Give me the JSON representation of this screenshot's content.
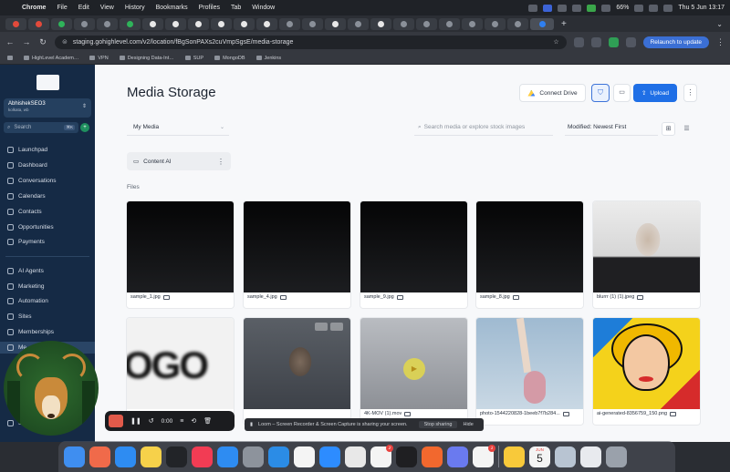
{
  "menubar": {
    "apple": "",
    "items": [
      "Chrome",
      "File",
      "Edit",
      "View",
      "History",
      "Bookmarks",
      "Profiles",
      "Tab",
      "Window"
    ],
    "battery": "66%",
    "datetime": "Thu 5 Jun  13:17"
  },
  "browser": {
    "new_tab": "+",
    "url": "staging.gohighlevel.com/v2/location/fBgSonPAXs2cuVmpSgsE/media-storage",
    "relaunch": "Relaunch to update",
    "bookmarks": [
      "HighLevel Academ…",
      "VPN",
      "Designing Data-Int…",
      "SUP",
      "MongoDB",
      "Jenkins"
    ]
  },
  "sidebar": {
    "account_name": "AbhishekSEO3",
    "account_sub": "kolkata, wb",
    "search_placeholder": "Search",
    "search_shortcut": "⌘K",
    "items": [
      {
        "label": "Launchpad",
        "icon": "rocket-icon"
      },
      {
        "label": "Dashboard",
        "icon": "dashboard-icon"
      },
      {
        "label": "Conversations",
        "icon": "chat-icon"
      },
      {
        "label": "Calendars",
        "icon": "calendar-icon"
      },
      {
        "label": "Contacts",
        "icon": "contacts-icon"
      },
      {
        "label": "Opportunities",
        "icon": "opportunities-icon"
      },
      {
        "label": "Payments",
        "icon": "payments-icon"
      },
      {
        "label": "AI Agents",
        "icon": "ai-agents-icon"
      },
      {
        "label": "Marketing",
        "icon": "marketing-icon"
      },
      {
        "label": "Automation",
        "icon": "automation-icon"
      },
      {
        "label": "Sites",
        "icon": "sites-icon"
      },
      {
        "label": "Memberships",
        "icon": "memberships-icon"
      },
      {
        "label": "Me",
        "icon": "media-icon"
      }
    ],
    "settings_label": "S"
  },
  "main": {
    "title": "Media Storage",
    "connect_drive": "Connect Drive",
    "upload": "Upload",
    "media_select": "My Media",
    "search_placeholder": "Search media or explore stock images",
    "sort": "Modified: Newest First",
    "folder_name": "Content AI",
    "files_label": "Files",
    "files": [
      {
        "name": "sample_1.jpg",
        "thumb": "black"
      },
      {
        "name": "sample_4.jpg",
        "thumb": "black"
      },
      {
        "name": "sample_9.jpg",
        "thumb": "black"
      },
      {
        "name": "sample_8.jpg",
        "thumb": "black"
      },
      {
        "name": "blurrr (1) (1).jpeg",
        "thumb": "woman"
      },
      {
        "name": "",
        "thumb": "logo",
        "thumb_text": "OGO"
      },
      {
        "name": "",
        "thumb": "man"
      },
      {
        "name": "4K-MOV (1).mov",
        "thumb": "video"
      },
      {
        "name": "photo-1544220828-1beeb7f7b284...",
        "thumb": "shoe"
      },
      {
        "name": "ai-generated-8356759_150.png",
        "thumb": "popart"
      }
    ]
  },
  "loom": {
    "time": "0:00",
    "share_text": "Loom – Screen Recorder & Screen Capture is sharing your screen.",
    "stop_sharing": "Stop sharing",
    "hide": "Hide"
  },
  "dock": {
    "apps": [
      {
        "name": "finder",
        "color": "#3f8ef0"
      },
      {
        "name": "launchpad",
        "color": "#f06a4a"
      },
      {
        "name": "safari",
        "color": "#2e8cf2"
      },
      {
        "name": "notes",
        "color": "#f6d14a"
      },
      {
        "name": "terminal",
        "color": "#222428"
      },
      {
        "name": "music",
        "color": "#f23c54"
      },
      {
        "name": "app-store",
        "color": "#2e8cf2"
      },
      {
        "name": "system-settings",
        "color": "#8d939c"
      },
      {
        "name": "vscode",
        "color": "#2b8ce6"
      },
      {
        "name": "postman",
        "color": "#f4f4f4"
      },
      {
        "name": "zoom",
        "color": "#2d8cff"
      },
      {
        "name": "chrome",
        "color": "#e8e8e8"
      },
      {
        "name": "slack",
        "color": "#f4f4f4",
        "badge": "2"
      },
      {
        "name": "cursor",
        "color": "#1f1f22"
      },
      {
        "name": "pen",
        "color": "#f2682e"
      },
      {
        "name": "settings-gear",
        "color": "#6a7aef"
      },
      {
        "name": "reminders",
        "color": "#f4f4f4",
        "badge": "1"
      },
      {
        "name": "tips",
        "color": "#f8c93a"
      },
      {
        "name": "calendar",
        "color": "#f4f4f4",
        "day": "5",
        "month": "JUN"
      },
      {
        "name": "preview",
        "color": "#b8c4d2"
      },
      {
        "name": "documents",
        "color": "#e8eaee"
      },
      {
        "name": "trash",
        "color": "#9aa1ab"
      }
    ]
  }
}
